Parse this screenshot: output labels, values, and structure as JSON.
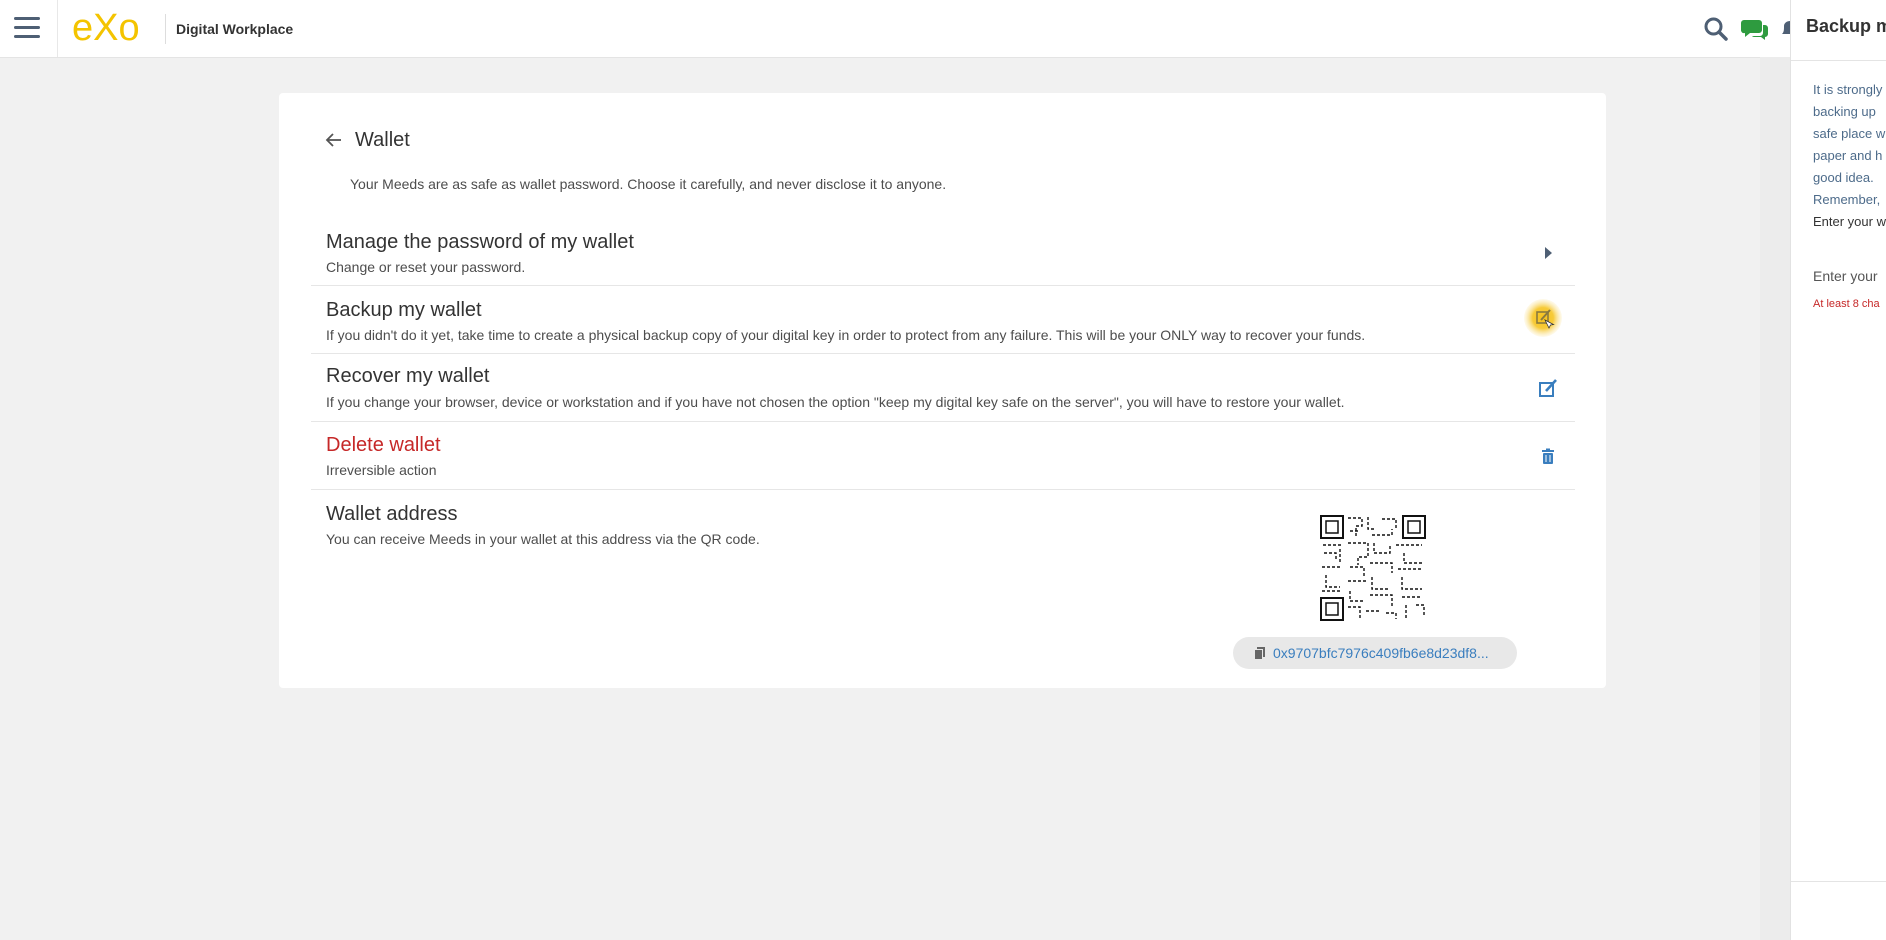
{
  "topbar": {
    "logo_text": "eXo",
    "site_name": "Digital Workplace",
    "accent_color": "#f4c400"
  },
  "wallet": {
    "title": "Wallet",
    "subtitle": "Your Meeds are as safe as wallet password. Choose it carefully, and never disclose it to anyone.",
    "items": [
      {
        "title": "Manage the password of my wallet",
        "description": "Change or reset your password.",
        "action_icon": "chevron-right-icon"
      },
      {
        "title": "Backup my wallet",
        "description": "If you didn't do it yet, take time to create a physical backup copy of your digital key in order to protect from any failure. This will be your ONLY way to recover your funds.",
        "action_icon": "edit-icon"
      },
      {
        "title": "Recover my wallet",
        "description": "If you change your browser, device or workstation and if you have not chosen the option \"keep my digital key safe on the server\", you will have to restore your wallet.",
        "action_icon": "edit-icon"
      },
      {
        "title": "Delete wallet",
        "description": "Irreversible action",
        "action_icon": "trash-icon",
        "title_color": "#c62828"
      },
      {
        "title": "Wallet address",
        "description": "You can receive Meeds in your wallet at this address via the QR code."
      }
    ],
    "address": "0x9707bfc7976c409fb6e8d23df8..."
  },
  "drawer": {
    "title": "Backup m",
    "lines": [
      "It is strongly",
      "backing up",
      "safe place w",
      "paper and h",
      "good idea.",
      "Remember,"
    ],
    "prompt": "Enter your w",
    "input_label": "Enter your",
    "error": "At least 8 cha"
  }
}
